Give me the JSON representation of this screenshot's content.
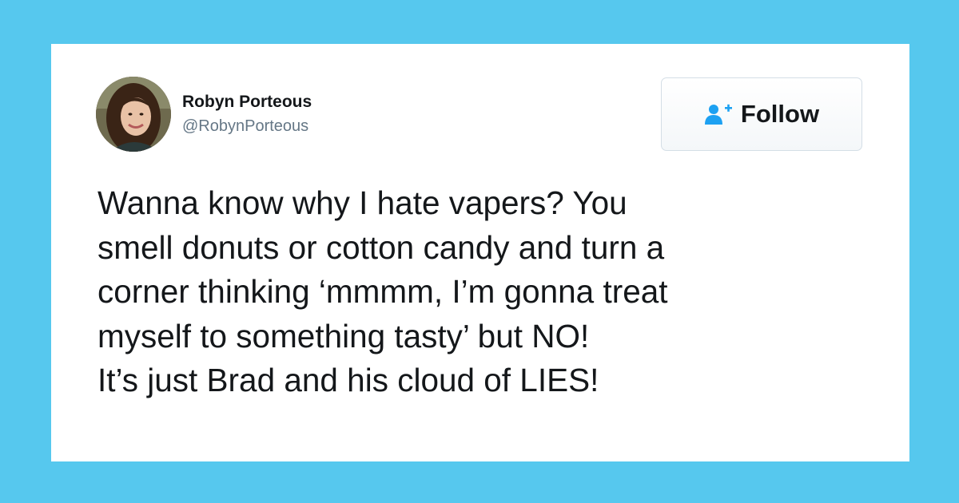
{
  "background_color": "#56c8ee",
  "accent_color": "#1da1f2",
  "author": {
    "name": "Robyn Porteous",
    "handle": "@RobynPorteous",
    "avatar_icon": "profile-photo"
  },
  "follow_button": {
    "icon": "add-user-icon",
    "label": "Follow"
  },
  "tweet": {
    "lines": [
      "Wanna know why I hate vapers? You",
      "smell donuts or cotton candy and turn a",
      "corner thinking ‘mmmm, I’m gonna treat",
      "myself to something tasty’ but NO!",
      "It’s just Brad and his cloud of LIES!"
    ]
  }
}
